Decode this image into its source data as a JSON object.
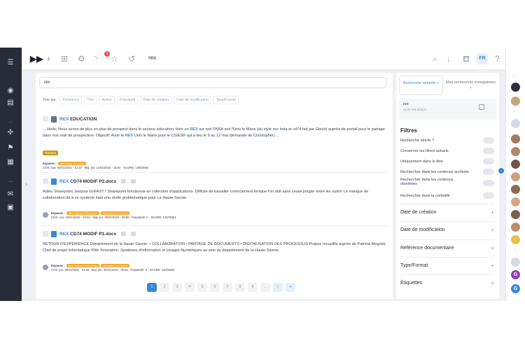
{
  "topbar": {
    "search_value": "rex",
    "lang": "FR",
    "notification_count": "1",
    "help": "?"
  },
  "main": {
    "search_value": "rex",
    "sort_label": "Trier par :",
    "sort_options": [
      "Pertinence",
      "Titre",
      "Auteur",
      "Popularité",
      "Date de création",
      "Date de modification",
      "Type/Format"
    ],
    "results": [
      {
        "title_highlight": "REX",
        "title_rest": " EDUCATION",
        "text_parts": [
          "... Hello, Nous avons de plus en plus de prospect dans le secteur éducation, faire un ",
          "REX",
          " sur soit l'INSA soit l'Univ le Mans (du style ",
          "rex",
          " bota et cd74 fait par Gtech) auprès de portail pour le partage dans nos mail de prospection. Objectif: Avoir le ",
          "REX",
          " Univ le Mans pour le CSIESR qui à lieu le 9 au 12 mai (demande de Christopher) ..."
        ],
        "tag": "Terminé",
        "espaces_label": "Espaces :",
        "espaces": [
          "Marketing et Comm"
        ],
        "meta": "Créé: mar. 04/01/2022 - 12:16 · Maj: jeu. 11/01/2024 - 15:04 · SCORE: 14943592"
      },
      {
        "title_highlight": "REX",
        "title_rest": " CD74 MODIF P2.docx",
        "text": "Adieu Sharepoint, bonjour GoFAST ! Sharepoint fonctionne en collection d'applications. Difficile de travailler correctement lorsque l'on doit sans cesse jongler entre les outils! Le manque de collaboration dû à ce système était une réelle problématique pour La Haute-Savoie.",
        "espaces_label": "Espaces :",
        "espaces": [
          "Mon Espace Personnel",
          "Marketing et Comm"
        ],
        "meta": "Créé: ven. 10/01/2023 - 10:04 · Maj: jeu. 30/01/2023 - 09:55 · Popularité: 0 · SCORE: 13476954"
      },
      {
        "title_highlight": "REX",
        "title_rest": " CD74 MODIF P1.docx",
        "text": "RETOUR D'EXPÉRIENCE Département de la Haute-Savoie. • COLLABORATION • PARTAGE DE DOCUMENTS • DIGITALISATION DES PROCESSUS Propos recueillis auprès de Patricia Mugnier, Chef de projet Informatique Pôle Innovation, Systèmes d'information et Usages Numériques au sein du département de la Haute-Savoie.",
        "espaces_label": "Espaces :",
        "espaces": [
          "Mon Espace Personnel",
          "Marketing et Comm"
        ],
        "meta": "Créé: jeu. 09/11/2022 - 12:26 · Maj: jeu. 30/11/2022 - 09:53 · Popularité: 0 · SCORE: 13475932"
      }
    ],
    "pages": [
      "1",
      "2",
      "3",
      "4",
      "5",
      "6",
      "7",
      "8",
      "9",
      "...",
      "›",
      "»"
    ]
  },
  "panel": {
    "tab_current": "Recherche actuelle",
    "tab_saved": "Mes recherches enregistrées",
    "saved_query": "rex",
    "saved_count": "1100 résultat(s)",
    "filters_title": "Filtres",
    "toggles": [
      "Recherche stricte ?",
      "Conserver les filtres actuels",
      "Uniquement dans le titre",
      "Rechercher dans les contenus archivés",
      "Rechercher dans les contenus obsolètes",
      "Rechercher dans la corbeille"
    ],
    "sections": [
      "Date de création",
      "Date de modification",
      "Référence documentaire",
      "Type/Format",
      "Étiquettes"
    ]
  },
  "colors": {
    "accent": "#3a88d8",
    "sidebar": "#272c38",
    "tag": "#c79a16",
    "pill": "#f5a623"
  }
}
